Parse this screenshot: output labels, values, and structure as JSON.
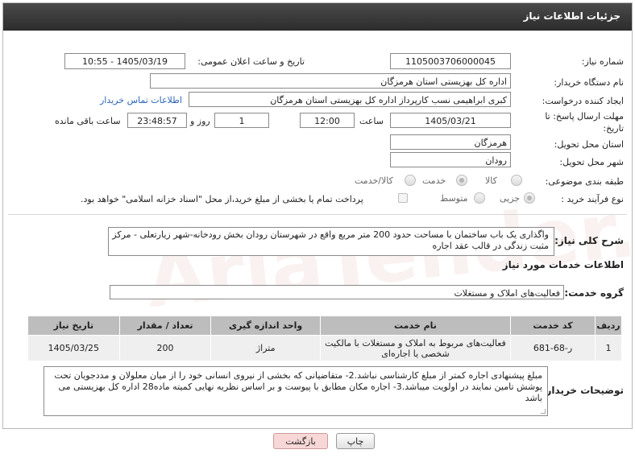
{
  "header": {
    "title": "جزئیات اطلاعات نیاز"
  },
  "form": {
    "need_number_label": "شماره نیاز:",
    "need_number": "1105003706000045",
    "announce_label": "تاریخ و ساعت اعلان عمومی:",
    "announce_value": "1405/03/19 - 10:55",
    "buyer_org_label": "نام دستگاه خریدار:",
    "buyer_org": "اداره کل بهزیستی استان هرمزگان",
    "creator_label": "ایجاد کننده درخواست:",
    "creator": "کبری  ابراهیمی نسب کارپرداز اداره کل بهزیستی استان هرمزگان",
    "contact_link": "اطلاعات تماس خریدار",
    "deadline_label": "مهلت ارسال پاسخ: تا تاریخ:",
    "deadline_date": "1405/03/21",
    "time_label": "ساعت",
    "deadline_time": "12:00",
    "days_value": "1",
    "days_label": "روز و",
    "remaining_time": "23:48:57",
    "remaining_label": "ساعت باقی مانده",
    "province_label": "استان محل تحویل:",
    "province": "هرمزگان",
    "city_label": "شهر محل تحویل:",
    "city": "رودان",
    "category_label": "طبقه بندی موضوعی:",
    "category_options": [
      "کالا",
      "خدمت",
      "کالا/خدمت"
    ],
    "purchase_label": "نوع فرآیند خرید :",
    "purchase_options": [
      "جزیی",
      "متوسط"
    ],
    "purchase_note": "پرداخت تمام یا بخشی از مبلغ خرید،از محل \"اسناد خزانه اسلامی\" خواهد بود."
  },
  "description": {
    "label": "شرح کلی نیاز:",
    "text": "واگذاری یک باب ساختمان با مساحت حدود 200 متر مربع واقع در شهرستان  رودان بخش رودخانه-شهر زیارتعلی - مرکز مثبت زندگی در قالب عقد اجاره"
  },
  "services": {
    "section_title": "اطلاعات خدمات مورد نیاز",
    "group_label": "گروه خدمت:",
    "group_value": "فعالیت‌های  املاک و مستغلات",
    "columns": [
      "ردیف",
      "کد خدمت",
      "نام خدمت",
      "واحد اندازه گیری",
      "تعداد / مقدار",
      "تاریخ نیاز"
    ],
    "rows": [
      [
        "1",
        "ر-68-681",
        "فعالیت‌های مربوط به املاک و مستغلات با مالکیت شخصی یا اجاره‌ای",
        "متراژ",
        "200",
        "1405/03/25"
      ]
    ]
  },
  "buyer_notes": {
    "label": "توضیحات خریدار:",
    "text": "مبلغ پیشنهادی  اجاره کمتر از مبلغ کارشناسی نباشد.2- متقاضیانی که بخشی از نیروی انسانی خود را از میان معلولان و مددجویان تحت پوشش تامین نمایند در اولویت میباشد.3-  اجاره مکان  مطابق با پیوست و بر اساس نظریه نهایی کمیته ماده28 اداره کل بهزیستی می باشد"
  },
  "buttons": {
    "print": "چاپ",
    "back": "بازگشت"
  },
  "watermark": "AriaTender.neT",
  "colors": {
    "header_bg": "#3a3a3a",
    "table_header": "#bdbdbd",
    "back_button": "#f8d7d7",
    "link": "#2a66b8"
  }
}
